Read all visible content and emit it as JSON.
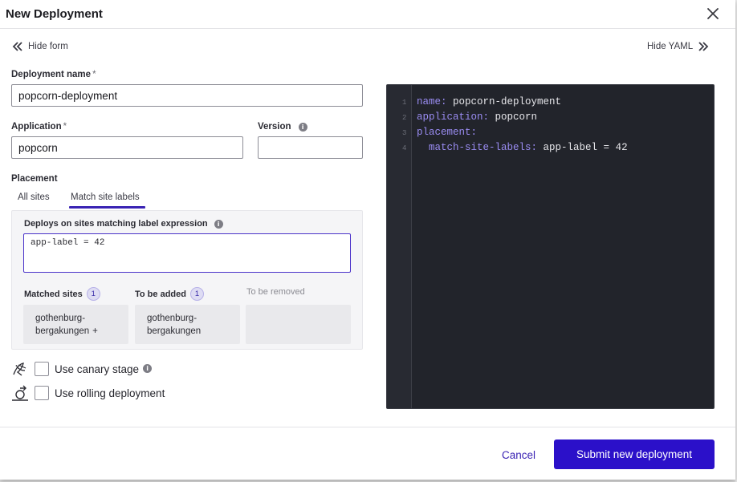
{
  "modal": {
    "title": "New Deployment",
    "hide_form_label": "Hide form",
    "hide_yaml_label": "Hide YAML"
  },
  "form": {
    "deployment_name": {
      "label": "Deployment name",
      "required_mark": "*",
      "value": "popcorn-deployment"
    },
    "application": {
      "label": "Application",
      "required_mark": "*",
      "value": "popcorn"
    },
    "version": {
      "label": "Version",
      "value": ""
    },
    "placement": {
      "label": "Placement",
      "tabs": [
        {
          "label": "All sites",
          "active": false
        },
        {
          "label": "Match site labels",
          "active": true
        }
      ],
      "expression_label": "Deploys on sites matching label expression",
      "expression_value": "app-label = 42",
      "matched_sites": {
        "title": "Matched sites",
        "count": "1",
        "sites": [
          {
            "name_line1": "gothenburg-",
            "name_line2": "bergakungen",
            "suffix": "+"
          }
        ]
      },
      "to_be_added": {
        "title": "To be added",
        "count": "1",
        "sites": [
          {
            "name_line1": "gothenburg-",
            "name_line2": "bergakungen"
          }
        ]
      },
      "to_be_removed": {
        "title": "To be removed"
      }
    },
    "options": [
      {
        "label": "Use canary stage",
        "checked": false,
        "icon": "canary-bird-icon"
      },
      {
        "label": "Use rolling deployment",
        "checked": false,
        "icon": "rolling-deployment-icon"
      }
    ]
  },
  "yaml": {
    "lines": [
      {
        "no": "1",
        "key": "name:",
        "value": " popcorn-deployment",
        "indent": ""
      },
      {
        "no": "2",
        "key": "application:",
        "value": " popcorn",
        "indent": ""
      },
      {
        "no": "3",
        "key": "placement:",
        "value": "",
        "indent": ""
      },
      {
        "no": "4",
        "key": "match-site-labels:",
        "value": " app-label = 42",
        "indent": "  "
      }
    ]
  },
  "footer": {
    "cancel_label": "Cancel",
    "submit_label": "Submit new deployment"
  },
  "colors": {
    "accent": "#2b10c9",
    "yaml_bg": "#22242b",
    "yaml_key": "#9a8cf2"
  }
}
